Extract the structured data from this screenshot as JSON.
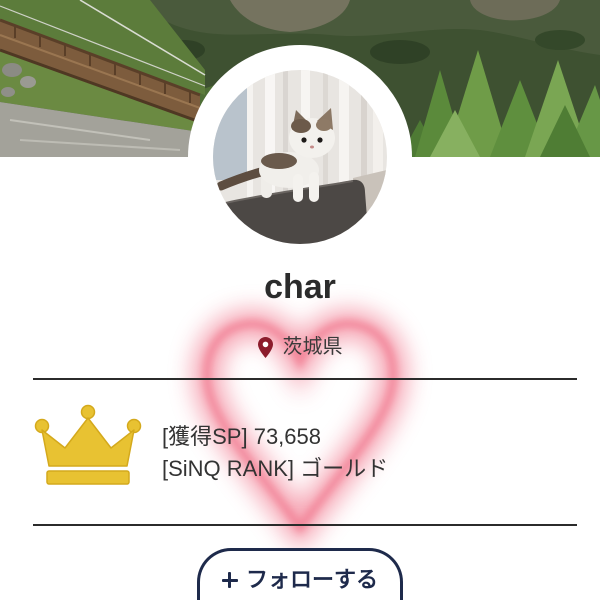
{
  "profile": {
    "name": "char",
    "location": "茨城県",
    "stats": [
      {
        "label": "[獲得SP]",
        "value": "73,658"
      },
      {
        "label": "[SiNQ RANK]",
        "value": "ゴールド"
      }
    ],
    "follow_button": {
      "label": "フォローする"
    }
  },
  "icons": {
    "location": "location-pin-icon",
    "rank": "crown-icon",
    "follow": "plus-icon",
    "decoration": "heart-glow"
  },
  "colors": {
    "text": "#2b2b2b",
    "pin": "#8c1c2c",
    "crown": "#e8c232",
    "heart_glow": "#ee5a74",
    "button": "#1e2a4b",
    "divider": "#2b2b2b"
  }
}
